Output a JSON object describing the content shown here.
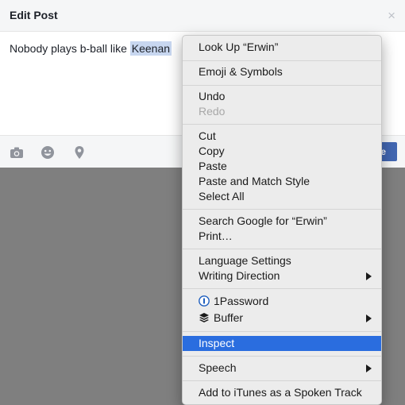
{
  "dialog": {
    "title": "Edit Post",
    "close": "×",
    "post_text_before": "Nobody plays b-ball like ",
    "post_text_selected": "Keenan"
  },
  "footer": {
    "icons": [
      "camera-icon",
      "emoji-icon",
      "location-pin-icon"
    ],
    "post_button_label": "e"
  },
  "context_menu": {
    "look_up": "Look Up “Erwin”",
    "emoji_symbols": "Emoji & Symbols",
    "undo": "Undo",
    "redo": "Redo",
    "cut": "Cut",
    "copy": "Copy",
    "paste": "Paste",
    "paste_match": "Paste and Match Style",
    "select_all": "Select All",
    "search_google": "Search Google for “Erwin”",
    "print": "Print…",
    "language_settings": "Language Settings",
    "writing_direction": "Writing Direction",
    "onepassword": "1Password",
    "buffer": "Buffer",
    "inspect": "Inspect",
    "speech": "Speech",
    "itunes": "Add to iTunes as a Spoken Track"
  },
  "colors": {
    "highlight": "#2a6ddf",
    "selection": "#c8d7f0",
    "overlay": "#7f7f7f",
    "post_button": "#4267b2"
  }
}
